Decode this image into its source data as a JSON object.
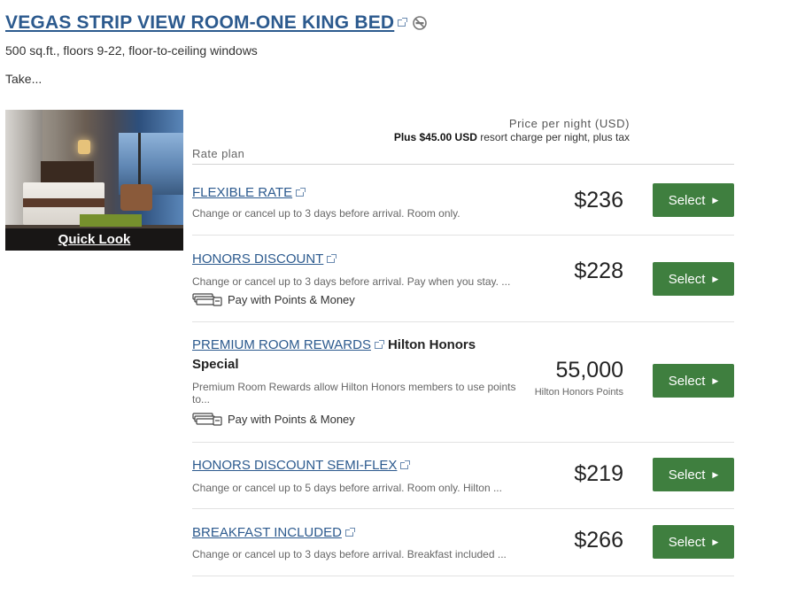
{
  "room": {
    "title": "VEGAS STRIP VIEW ROOM-ONE KING BED",
    "description": "500 sq.ft., floors 9-22, floor-to-ceiling windows",
    "take": "Take...",
    "photo_caption": "Quick Look",
    "icons": [
      "external-link-icon",
      "no-smoking-icon"
    ]
  },
  "rates_header": {
    "rate_plan_label": "Rate plan",
    "price_label": "Price per night (USD)",
    "resort_charge_bold": "Plus $45.00 USD",
    "resort_charge_rest": "resort charge per night, plus tax"
  },
  "rates": [
    {
      "name": "FLEXIBLE RATE",
      "description": "Change or cancel up to 3 days before arrival. Room only.",
      "price": "$236",
      "button": "Select"
    },
    {
      "name": "HONORS DISCOUNT",
      "description": "Change or cancel up to 3 days before arrival. Pay when you stay. ...",
      "pay_with_points": "Pay with Points & Money",
      "price": "$228",
      "button": "Select"
    },
    {
      "name": "PREMIUM ROOM REWARDS",
      "extra": "Hilton Honors",
      "extra_line2": "Special",
      "description": "Premium Room Rewards allow Hilton Honors members to use points to...",
      "pay_with_points": "Pay with Points & Money",
      "price": "55,000",
      "price_unit": "Hilton Honors Points",
      "button": "Select"
    },
    {
      "name": "HONORS DISCOUNT SEMI-FLEX",
      "description": "Change or cancel up to 5 days before arrival. Room only. Hilton ...",
      "price": "$219",
      "button": "Select"
    },
    {
      "name": "BREAKFAST INCLUDED",
      "description": "Change or cancel up to 3 days before arrival. Breakfast included ...",
      "price": "$266",
      "button": "Select"
    }
  ],
  "colors": {
    "link": "#2c5a8e",
    "select_button": "#3f7f3f"
  }
}
